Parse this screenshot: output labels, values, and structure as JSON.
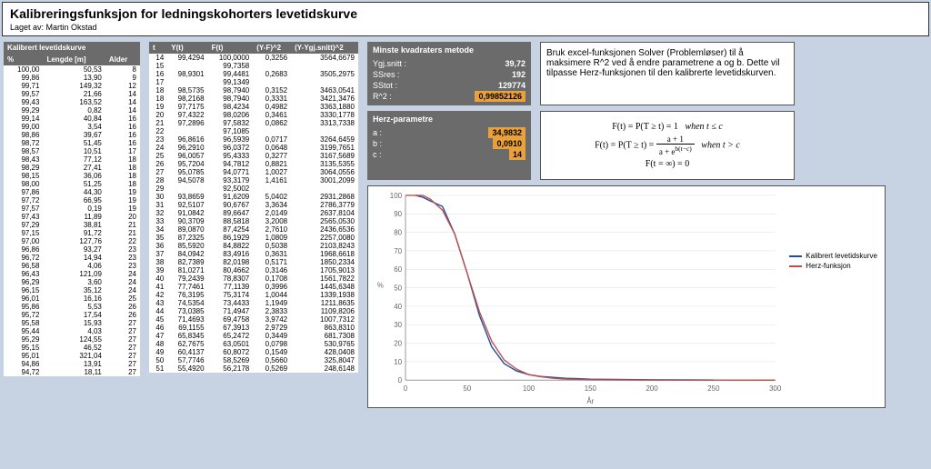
{
  "header": {
    "title": "Kalibreringsfunksjon for ledningskohorters levetidskurve",
    "author_label": "Laget av:",
    "author": "Martin Okstad"
  },
  "table1": {
    "title": "Kalibrert levetidskurve",
    "cols": [
      "%",
      "Lengde [m]",
      "Alder"
    ],
    "rows": [
      [
        100.0,
        50.53,
        8
      ],
      [
        99.86,
        13.9,
        9
      ],
      [
        99.71,
        149.32,
        12
      ],
      [
        99.57,
        21.66,
        14
      ],
      [
        99.43,
        163.52,
        14
      ],
      [
        99.29,
        0.82,
        14
      ],
      [
        99.14,
        40.84,
        16
      ],
      [
        99.0,
        3.54,
        16
      ],
      [
        98.86,
        39.67,
        16
      ],
      [
        98.72,
        51.45,
        16
      ],
      [
        98.57,
        10.51,
        17
      ],
      [
        98.43,
        77.12,
        18
      ],
      [
        98.29,
        27.41,
        18
      ],
      [
        98.15,
        36.06,
        18
      ],
      [
        98.0,
        51.25,
        18
      ],
      [
        97.86,
        44.3,
        19
      ],
      [
        97.72,
        66.95,
        19
      ],
      [
        97.57,
        0.19,
        19
      ],
      [
        97.43,
        11.89,
        20
      ],
      [
        97.29,
        38.81,
        21
      ],
      [
        97.15,
        91.72,
        21
      ],
      [
        97.0,
        127.76,
        22
      ],
      [
        96.86,
        93.27,
        23
      ],
      [
        96.72,
        14.94,
        23
      ],
      [
        96.58,
        4.06,
        23
      ],
      [
        96.43,
        121.09,
        24
      ],
      [
        96.29,
        3.6,
        24
      ],
      [
        96.15,
        35.12,
        24
      ],
      [
        96.01,
        16.16,
        25
      ],
      [
        95.86,
        5.53,
        26
      ],
      [
        95.72,
        17.54,
        26
      ],
      [
        95.58,
        15.93,
        27
      ],
      [
        95.44,
        4.03,
        27
      ],
      [
        95.29,
        124.55,
        27
      ],
      [
        95.15,
        46.52,
        27
      ],
      [
        95.01,
        321.04,
        27
      ],
      [
        94.86,
        13.91,
        27
      ],
      [
        94.72,
        18.11,
        27
      ]
    ]
  },
  "table2": {
    "cols": [
      "t",
      "Y(t)",
      "F(t)",
      "(Y-F)^2",
      "(Y-Ygj.snitt)^2"
    ],
    "rows": [
      [
        14,
        99.4294,
        100.0,
        0.3256,
        3564.6679
      ],
      [
        15,
        null,
        99.7358,
        null,
        null
      ],
      [
        16,
        98.9301,
        99.4481,
        0.2683,
        3505.2975
      ],
      [
        17,
        null,
        99.1349,
        null,
        null
      ],
      [
        18,
        98.5735,
        98.794,
        0.3152,
        3463.0541
      ],
      [
        18,
        98.2168,
        98.794,
        0.3331,
        3421.3476
      ],
      [
        19,
        97.7175,
        98.4234,
        0.4982,
        3363.188
      ],
      [
        20,
        97.4322,
        98.0206,
        0.3461,
        3330.1778
      ],
      [
        21,
        97.2896,
        97.5832,
        0.0862,
        3313.7338
      ],
      [
        22,
        null,
        97.1085,
        null,
        null
      ],
      [
        23,
        96.8616,
        96.5939,
        0.0717,
        3264.6459
      ],
      [
        24,
        96.291,
        96.0372,
        0.0648,
        3199.7651
      ],
      [
        25,
        96.0057,
        95.4333,
        0.3277,
        3167.5689
      ],
      [
        26,
        95.7204,
        94.7812,
        0.8821,
        3135.5355
      ],
      [
        27,
        95.0785,
        94.0771,
        1.0027,
        3064.0556
      ],
      [
        28,
        94.5078,
        93.3179,
        1.4161,
        3001.2099
      ],
      [
        29,
        null,
        92.5002,
        null,
        null
      ],
      [
        30,
        93.8659,
        91.6209,
        5.0402,
        2931.2868
      ],
      [
        31,
        92.5107,
        90.6767,
        3.3634,
        2786.3779
      ],
      [
        32,
        91.0842,
        89.6647,
        2.0149,
        2637.8104
      ],
      [
        33,
        90.3709,
        88.5818,
        3.2008,
        2565.053
      ],
      [
        34,
        89.087,
        87.4254,
        2.761,
        2436.6536
      ],
      [
        35,
        87.2325,
        86.1929,
        1.0809,
        2257.008
      ],
      [
        36,
        85.592,
        84.8822,
        0.5038,
        2103.8243
      ],
      [
        37,
        84.0942,
        83.4916,
        0.3631,
        1968.6618
      ],
      [
        38,
        82.7389,
        82.0198,
        0.5171,
        1850.2334
      ],
      [
        39,
        81.0271,
        80.4662,
        0.3146,
        1705.9013
      ],
      [
        40,
        79.2439,
        78.8307,
        0.1708,
        1561.7822
      ],
      [
        41,
        77.7461,
        77.1139,
        0.3996,
        1445.6348
      ],
      [
        42,
        76.3195,
        75.3174,
        1.0044,
        1339.1938
      ],
      [
        43,
        74.5354,
        73.4433,
        1.1949,
        1211.8635
      ],
      [
        44,
        73.0385,
        71.4947,
        2.3833,
        1109.8206
      ],
      [
        45,
        71.4693,
        69.4758,
        3.9742,
        1007.7312
      ],
      [
        46,
        69.1155,
        67.3913,
        2.9729,
        863.831
      ],
      [
        47,
        65.8345,
        65.2472,
        0.3449,
        681.7308
      ],
      [
        48,
        62.7675,
        63.0501,
        0.0798,
        530.9765
      ],
      [
        49,
        60.4137,
        60.8072,
        0.1549,
        428.0408
      ],
      [
        50,
        57.7746,
        58.5269,
        0.566,
        325.8047
      ],
      [
        51,
        55.492,
        56.2178,
        0.5269,
        248.6148
      ]
    ]
  },
  "lsq_panel": {
    "title": "Minste kvadraters metode",
    "rows": [
      {
        "label": "Ygj.snitt :",
        "value": "39,72"
      },
      {
        "label": "SSres :",
        "value": "192"
      },
      {
        "label": "SStot :",
        "value": "129774"
      },
      {
        "label": "R^2 :",
        "value": "0,99852126",
        "highlight": true
      }
    ]
  },
  "info_text": "Bruk excel-funksjonen Solver (Problemløser) til å maksimere R^2 ved å endre parametrene a og b. Dette vil tilpasse Herz-funksjonen til den kalibrerte levetidskurven.",
  "herz_panel": {
    "title": "Herz-parametre",
    "rows": [
      {
        "label": "a :",
        "value": "34,9832",
        "highlight": true
      },
      {
        "label": "b :",
        "value": "0,0910",
        "highlight": true
      },
      {
        "label": "c :",
        "value": "14",
        "highlight": true
      }
    ]
  },
  "formulas": {
    "line1_left": "F(t) = P(T ≥ t) = 1",
    "line1_right": "when t ≤ c",
    "line2_left": "F(t) = P(T ≥ t) =",
    "line2_num": "a + 1",
    "line2_den": "a + e",
    "line2_exp": "b(t−c)",
    "line2_right": "when t > c",
    "line3": "F(t = ∞) = 0"
  },
  "chart_data": {
    "type": "line",
    "xlabel": "År",
    "ylabel": "%",
    "xlim": [
      0,
      300
    ],
    "ylim": [
      0,
      100
    ],
    "xticks": [
      0,
      50,
      100,
      150,
      200,
      250,
      300
    ],
    "yticks": [
      0,
      10,
      20,
      30,
      40,
      50,
      60,
      70,
      80,
      90,
      100
    ],
    "series": [
      {
        "name": "Kalibrert levetidskurve",
        "color": "#1f4e9c",
        "x": [
          8,
          14,
          20,
          30,
          40,
          50,
          60,
          70,
          80,
          90,
          100,
          110,
          120,
          130,
          140,
          150,
          200,
          250
        ],
        "y": [
          100,
          99,
          97,
          94,
          79,
          58,
          35,
          18,
          9,
          5,
          3,
          2,
          1.5,
          1,
          0.8,
          0.5,
          0.2,
          0.1
        ]
      },
      {
        "name": "Herz-funksjon",
        "color": "#c0504d",
        "x": [
          0,
          14,
          20,
          30,
          40,
          50,
          60,
          70,
          80,
          90,
          100,
          110,
          120,
          130,
          140,
          150,
          200,
          250,
          300
        ],
        "y": [
          100,
          100,
          98,
          92,
          79,
          58,
          37,
          21,
          11,
          6,
          3,
          1.8,
          1,
          0.6,
          0.4,
          0.2,
          0.05,
          0.01,
          0
        ]
      }
    ]
  }
}
